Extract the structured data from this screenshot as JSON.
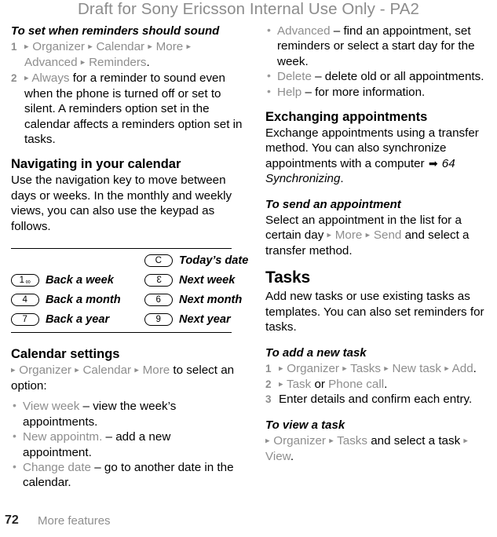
{
  "header": {
    "watermark": "Draft for Sony Ericsson Internal Use Only - PA2"
  },
  "left_column": {
    "proc_reminders": {
      "heading": "To set when reminders should sound",
      "steps": [
        {
          "num": "1",
          "arrow1": "▸",
          "menu1": "Organizer",
          "arrow2": "▸",
          "menu2": "Calendar",
          "arrow3": "▸",
          "menu3": "More",
          "arrow4": "▸",
          "menu4": "Advanced",
          "arrow5": "▸",
          "menu5": "Reminders",
          "tail": "."
        },
        {
          "num": "2",
          "arrow1": "▸",
          "menu1": "Always",
          "tail": " for a reminder to sound even when the phone is turned off or set to silent. A reminders option set in the calendar affects a reminders option set in tasks."
        }
      ]
    },
    "nav_section": {
      "heading": "Navigating in your calendar",
      "body": "Use the navigation key to move between days or weeks. In the monthly and weekly views, you can also use the keypad as follows."
    },
    "key_table": {
      "rows": [
        {
          "left_key": "",
          "left_key_extra": "",
          "left_label": "",
          "right_key": "C",
          "right_key_extra": "",
          "right_label": "Today’s date"
        },
        {
          "left_key": "1",
          "left_key_extra": "∞",
          "left_label": "Back a week",
          "right_key": "3",
          "right_key_extra": "",
          "right_label": "Next week"
        },
        {
          "left_key": "4",
          "left_key_extra": "",
          "left_label": "Back a month",
          "right_key": "6",
          "right_key_extra": "",
          "right_label": "Next month"
        },
        {
          "left_key": "7",
          "left_key_extra": "",
          "left_label": "Back a year",
          "right_key": "9",
          "right_key_extra": "",
          "right_label": "Next year"
        }
      ]
    },
    "settings_section": {
      "heading": "Calendar settings",
      "path_arrow1": "▸",
      "path_menu1": "Organizer",
      "path_arrow2": "▸",
      "path_menu2": "Calendar",
      "path_arrow3": "▸",
      "path_menu3": "More",
      "path_tail": " to select an option:",
      "options": [
        {
          "name": "View week",
          "desc": " – view the week’s appointments."
        },
        {
          "name": "New appointm.",
          "desc": " – add a new appointment."
        },
        {
          "name": "Change date",
          "desc": " – go to another date in the calendar."
        }
      ]
    }
  },
  "right_column": {
    "options_continued": [
      {
        "name": "Advanced",
        "desc": " – find an appointment, set reminders or select a start day for the week."
      },
      {
        "name": "Delete",
        "desc": " – delete old or all appointments."
      },
      {
        "name": "Help",
        "desc": " – for more information."
      }
    ],
    "exchanging_section": {
      "heading": "Exchanging appointments",
      "body_lead": "Exchange appointments using a transfer method. You can also synchronize appointments with a computer ",
      "xref_arrow": "➡",
      "xref": " 64 Synchronizing",
      "body_tail": "."
    },
    "proc_send": {
      "heading": "To send an appointment",
      "lead": "Select an appointment in the list for a certain day ",
      "arrow1": "▸",
      "menu1": "More",
      "arrow2": "▸",
      "menu2": "Send",
      "tail": " and select a transfer method."
    },
    "tasks_section": {
      "heading": "Tasks",
      "body": "Add new tasks or use existing tasks as templates. You can also set reminders for tasks."
    },
    "proc_add_task": {
      "heading": "To add a new task",
      "steps": [
        {
          "num": "1",
          "arrow1": "▸",
          "menu1": "Organizer",
          "arrow2": "▸",
          "menu2": "Tasks",
          "arrow3": "▸",
          "menu3": "New task",
          "arrow4": "▸",
          "menu4": "Add",
          "tail": "."
        },
        {
          "num": "2",
          "arrow1": "▸",
          "menu1": "Task",
          "conj": " or ",
          "menu2": "Phone call",
          "tail": "."
        },
        {
          "num": "3",
          "plain": "Enter details and confirm each entry."
        }
      ]
    },
    "proc_view_task": {
      "heading": "To view a task",
      "arrow1": "▸",
      "menu1": "Organizer",
      "arrow2": "▸",
      "menu2": "Tasks",
      "mid": " and select a task ",
      "arrow3": "▸",
      "menu3": "View",
      "tail": "."
    }
  },
  "footer": {
    "page_number": "72",
    "chapter": "More features"
  }
}
